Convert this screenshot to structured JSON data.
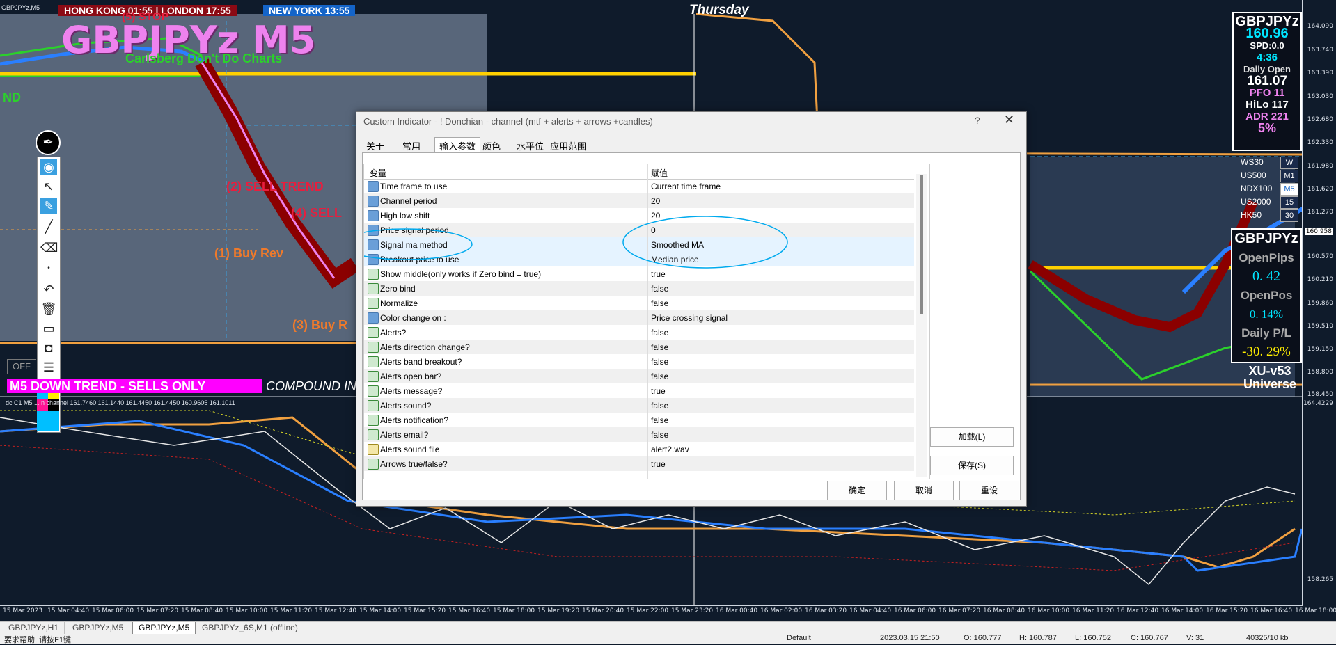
{
  "chart": {
    "symbol_tag": "GBPJPYz,M5",
    "thursday": "Thursday",
    "clocks": [
      {
        "label": "HONG KONG 01:55 | LONDON  17:55",
        "bg": "#8b0a14"
      },
      {
        "label": "NEW YORK 13:55",
        "bg": "#1464c8"
      }
    ],
    "big_title": "GBPJPYz M5",
    "sub_title": "Carlsberg Don't Do Charts",
    "labels": {
      "nd": "ND",
      "sell_trend": "(2) SELL TREND",
      "sell4": "(4) SELL",
      "buy_rev1": "(1) Buy Rev",
      "buy_rev3": "(3) Buy R",
      "stop_top": "(5) STOP"
    },
    "off": "OFF",
    "trend_banner": "M5  DOWN TREND - SELLS ONLY",
    "compound": "COMPOUND IN",
    "indicator_label": "dc C1 M5 ... n channel 161.7460 161.1440 161.4450 161.4450 160.9605 161.1011",
    "price_ticks": [
      "164.090",
      "163.740",
      "163.390",
      "163.030",
      "162.680",
      "162.330",
      "161.980",
      "161.620",
      "161.270",
      "160.958",
      "160.570",
      "160.210",
      "159.860",
      "159.510",
      "159.150",
      "158.800",
      "158.450",
      "164.4229",
      "158.265"
    ],
    "time_ticks": [
      "15 Mar 2023",
      "15 Mar 04:40",
      "15 Mar 06:00",
      "15 Mar 07:20",
      "15 Mar 08:40",
      "15 Mar 10:00",
      "15 Mar 11:20",
      "15 Mar 12:40",
      "15 Mar 14:00",
      "15 Mar 15:20",
      "15 Mar 16:40",
      "15 Mar 18:00",
      "15 Mar 19:20",
      "15 Mar 20:40",
      "15 Mar 22:00",
      "15 Mar 23:20",
      "16 Mar 00:40",
      "16 Mar 02:00",
      "16 Mar 03:20",
      "16 Mar 04:40",
      "16 Mar 06:00",
      "16 Mar 07:20",
      "16 Mar 08:40",
      "16 Mar 10:00",
      "16 Mar 11:20",
      "16 Mar 12:40",
      "16 Mar 14:00",
      "16 Mar 15:20",
      "16 Mar 16:40",
      "16 Mar 18:00"
    ]
  },
  "info_panel": {
    "symbol": "GBPJPYz",
    "price": "160.96",
    "spread": "SPD:0.0",
    "timer": "4:36",
    "daily_open_label": "Daily Open",
    "daily_open": "161.07",
    "pfo": "PFO  11",
    "hilo": "HiLo 117",
    "adr": "ADR 221",
    "pct": "5%"
  },
  "symbols": [
    {
      "name": "WS30",
      "tf": "W"
    },
    {
      "name": "US500",
      "tf": "M1"
    },
    {
      "name": "NDX100",
      "tf": "M5"
    },
    {
      "name": "US2000",
      "tf": "15"
    },
    {
      "name": "HK50",
      "tf": "30"
    }
  ],
  "pip_panel": {
    "symbol": "GBPJPYz",
    "open_pips_label": "OpenPips",
    "open_pips": "0. 42",
    "open_pos_label": "OpenPos",
    "open_pos": "0. 14%",
    "daily_pl_label": "Daily P/L",
    "daily_pl": "-30. 29%"
  },
  "xu": {
    "line1": "XU-v53",
    "line2": "Universe"
  },
  "dialog": {
    "title": "Custom Indicator - ! Donchian - channel (mtf + alerts + arrows +candles)",
    "help": "?",
    "close": "✕",
    "tabs": [
      "关于",
      "常用",
      "输入参数",
      "颜色",
      "水平位",
      "应用范围"
    ],
    "selected_tab": 2,
    "col_variable": "变量",
    "col_value": "赋值",
    "rows": [
      {
        "name": "Time frame to use",
        "value": "Current time frame",
        "type": "num"
      },
      {
        "name": "Channel period",
        "value": "20",
        "type": "num"
      },
      {
        "name": "High low shift",
        "value": "20",
        "type": "num"
      },
      {
        "name": "Price signal period",
        "value": "0",
        "type": "num"
      },
      {
        "name": "Signal ma method",
        "value": "Smoothed MA",
        "type": "num"
      },
      {
        "name": "Breakout price to use",
        "value": "Median price",
        "type": "num"
      },
      {
        "name": "Show middle(only works if Zero bind = true)",
        "value": "true",
        "type": "bool"
      },
      {
        "name": "Zero bind",
        "value": "false",
        "type": "bool"
      },
      {
        "name": "Normalize",
        "value": "false",
        "type": "bool"
      },
      {
        "name": "Color change on :",
        "value": "Price crossing signal",
        "type": "num"
      },
      {
        "name": "Alerts?",
        "value": "false",
        "type": "bool"
      },
      {
        "name": "Alerts direction change?",
        "value": "false",
        "type": "bool"
      },
      {
        "name": "Alerts band breakout?",
        "value": "false",
        "type": "bool"
      },
      {
        "name": "Alerts open bar?",
        "value": "false",
        "type": "bool"
      },
      {
        "name": "Alerts message?",
        "value": "true",
        "type": "bool"
      },
      {
        "name": "Alerts sound?",
        "value": "false",
        "type": "bool"
      },
      {
        "name": "Alerts notification?",
        "value": "false",
        "type": "bool"
      },
      {
        "name": "Alerts email?",
        "value": "false",
        "type": "bool"
      },
      {
        "name": "Alerts sound file",
        "value": "alert2.wav",
        "type": "str"
      },
      {
        "name": "Arrows true/false?",
        "value": "true",
        "type": "bool"
      }
    ],
    "load_btn": "加载(L)",
    "save_btn": "保存(S)",
    "ok_btn": "确定",
    "cancel_btn": "取消",
    "reset_btn": "重设"
  },
  "tabs": [
    {
      "label": "GBPJPYz,H1",
      "active": false
    },
    {
      "label": "GBPJPYz,M5",
      "active": false
    },
    {
      "label": "GBPJPYz,M5",
      "active": true
    },
    {
      "label": "GBPJPYz_6S,M1 (offline)",
      "active": false
    }
  ],
  "status": {
    "help": "要求帮助, 请按F1键",
    "profile": "Default",
    "datetime": "2023.03.15 21:50",
    "open": "O: 160.777",
    "high": "H: 160.787",
    "low": "L: 160.752",
    "close": "C: 160.767",
    "volume": "V: 31",
    "traffic": "40325/10 kb"
  },
  "colors": {
    "accent_magenta": "#ff00ff",
    "orange": "#f0a040",
    "green": "#2bd12b",
    "yellow": "#ffd000",
    "blue": "#2a7fff"
  }
}
